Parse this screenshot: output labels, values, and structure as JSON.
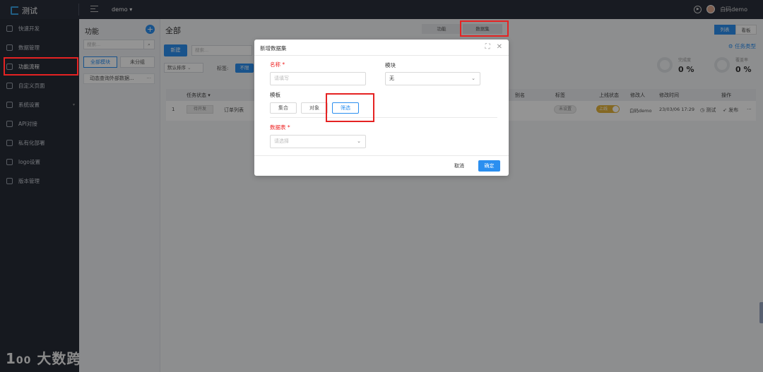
{
  "app": {
    "title": "测试",
    "project": "demo",
    "user": "白码demo"
  },
  "sidebar": {
    "items": [
      {
        "label": "快速开发",
        "icon": "lightning-icon"
      },
      {
        "label": "数据管理",
        "icon": "database-icon"
      },
      {
        "label": "功能流程",
        "icon": "flow-icon",
        "active": true
      },
      {
        "label": "自定义页面",
        "icon": "page-icon"
      },
      {
        "label": "系统设置",
        "icon": "gear-icon",
        "caret": "▾"
      },
      {
        "label": "API对接",
        "icon": "api-icon"
      },
      {
        "label": "私有化部署",
        "icon": "server-icon"
      },
      {
        "label": "logo设置",
        "icon": "image-icon"
      },
      {
        "label": "版本管理",
        "icon": "version-icon"
      }
    ]
  },
  "watermark": "大数跨境",
  "func_panel": {
    "title": "功能",
    "search_placeholder": "搜索...",
    "btn_all": "全部模块",
    "btn_ungrouped": "未分组",
    "item": "动态查询外部数据...",
    "item_more": "···"
  },
  "main": {
    "title": "全部",
    "seg_func": "功能",
    "seg_dataset": "数据集",
    "view_list": "列表",
    "view_board": "看板",
    "new_btn": "新建",
    "search_placeholder": "搜索...",
    "sort": "默认排序",
    "tag_label": "标签:",
    "tag_chip": "不限",
    "task_type": "任务类型",
    "stats": [
      {
        "label": "完成度",
        "value": "0 %"
      },
      {
        "label": "覆盖率",
        "value": "0 %"
      }
    ],
    "table": {
      "headers": {
        "status": "任务状态 ▾",
        "alias": "别名",
        "tag": "标签",
        "online": "上线状态",
        "modifier": "修改人",
        "mtime": "修改时间",
        "ops": "操作"
      },
      "row": {
        "index": "1",
        "status": "待开发",
        "name": "订单列表",
        "tag": "未设置",
        "online": "上线",
        "modifier": "白码demo",
        "mtime": "23/03/06 17:29",
        "test": "测试",
        "publish": "发布",
        "more": "···"
      }
    }
  },
  "modal": {
    "title": "新增数据集",
    "name_label": "名称",
    "required_mark": "*",
    "name_placeholder": "请填写",
    "module_label": "模块",
    "module_value": "无",
    "template_label": "模板",
    "templates": [
      "集合",
      "对象",
      "筛选"
    ],
    "selected_template": "筛选",
    "table_label": "数据表",
    "table_placeholder": "请选择",
    "cancel": "取消",
    "ok": "确定"
  },
  "colors": {
    "accent": "#2b8ff0",
    "highlight": "#e52222",
    "sidebar": "#262b36",
    "toggle": "#e4b43c"
  }
}
